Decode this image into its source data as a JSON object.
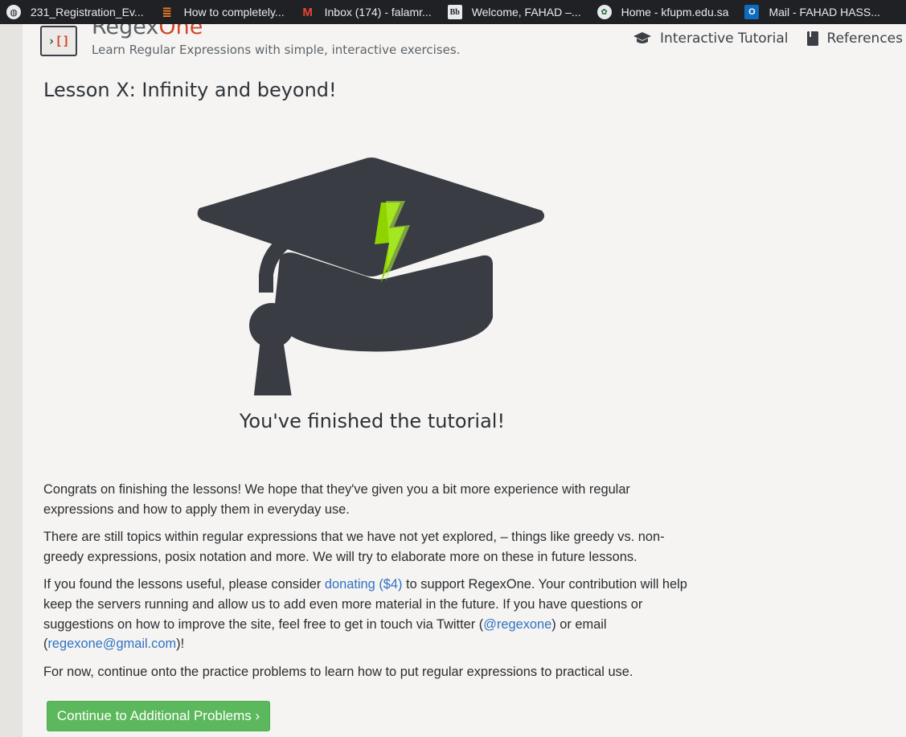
{
  "bookmarks": [
    {
      "icon": "globe-icon",
      "label": "231_Registration_Ev..."
    },
    {
      "icon": "stackoverflow-icon",
      "label": "How to completely..."
    },
    {
      "icon": "gmail-icon",
      "label": "Inbox (174) - falamr..."
    },
    {
      "icon": "blackboard-icon",
      "label": "Welcome, FAHAD –..."
    },
    {
      "icon": "kfupm-icon",
      "label": "Home - kfupm.edu.sa"
    },
    {
      "icon": "outlook-icon",
      "label": "Mail - FAHAD HASS..."
    }
  ],
  "site": {
    "logo_glyph_left": "›",
    "logo_glyph_right": "[]",
    "brand_part1": "Regex",
    "brand_part2": "One",
    "tagline": "Learn Regular Expressions with simple, interactive exercises."
  },
  "nav": {
    "tutorial": "Interactive Tutorial",
    "references": "References"
  },
  "lesson": {
    "title": "Lesson X: Infinity and beyond!",
    "finished": "You've finished the tutorial!",
    "p1": "Congrats on finishing the lessons! We hope that they've given you a bit more experience with regular expressions and how to apply them in everyday use.",
    "p2": "There are still topics within regular expressions that we have not yet explored, – things like greedy vs. non-greedy expressions, posix notation and more. We will try to elaborate more on these in future lessons.",
    "p3_a": "If you found the lessons useful, please consider ",
    "p3_link_donate": "donating ($4)",
    "p3_b": " to support RegexOne. Your contribution will help keep the servers running and allow us to add even more material in the future. If you have questions or suggestions on how to improve the site, feel free to get in touch via Twitter (",
    "p3_link_twitter": "@regexone",
    "p3_c": ") or email (",
    "p3_link_email": "regexone@gmail.com",
    "p3_d": ")!",
    "p4": "For now, continue onto the practice problems to learn how to put regular expressions to practical use.",
    "continue_label": "Continue to Additional Problems ›"
  },
  "colors": {
    "accent_red": "#d2452a",
    "button_green": "#5cb85c",
    "link_blue": "#2f73c4",
    "cap_dark": "#393c43",
    "bolt_green": "#8fd400"
  }
}
